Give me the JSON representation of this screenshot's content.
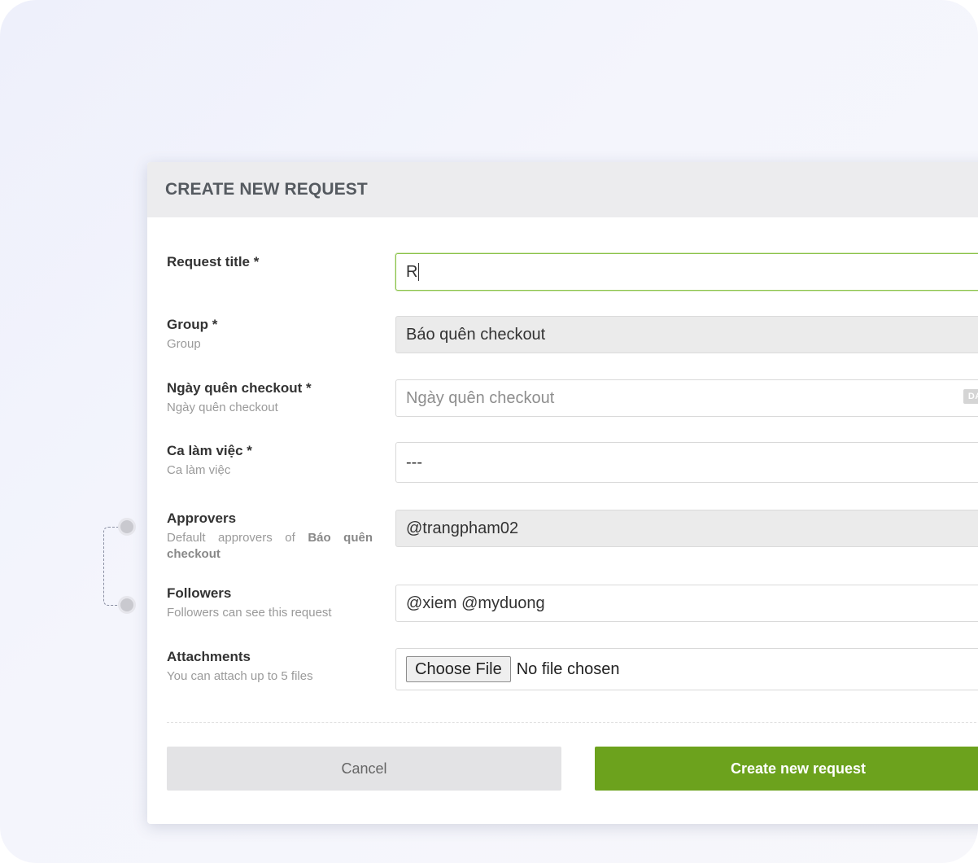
{
  "modal": {
    "title": "CREATE NEW REQUEST"
  },
  "form": {
    "request_title": {
      "label": "Request title *",
      "value": "R"
    },
    "group": {
      "label": "Group *",
      "sublabel": "Group",
      "value": "Báo quên checkout"
    },
    "forgot_date": {
      "label": "Ngày quên checkout *",
      "sublabel": "Ngày quên checkout",
      "placeholder": "Ngày quên checkout",
      "badge": "DATE"
    },
    "shift": {
      "label": "Ca làm việc *",
      "sublabel": "Ca làm việc",
      "selected": "---"
    },
    "approvers": {
      "label": "Approvers",
      "sublabel_prefix": "Default approvers of",
      "sublabel_group": "Báo quên checkout",
      "value": "@trangpham02"
    },
    "followers": {
      "label": "Followers",
      "sublabel": "Followers can see this request",
      "value": "@xiem @myduong"
    },
    "attachments": {
      "label": "Attachments",
      "sublabel": "You can attach up to 5 files",
      "button_label": "Choose File",
      "status": "No file chosen"
    }
  },
  "actions": {
    "cancel_label": "Cancel",
    "create_label": "Create new request"
  },
  "colors": {
    "accent_green": "#6ca21d",
    "focus_border": "#8bc34a",
    "header_bg": "#ececee"
  },
  "icons": {
    "select": "chevron-down-icon"
  }
}
